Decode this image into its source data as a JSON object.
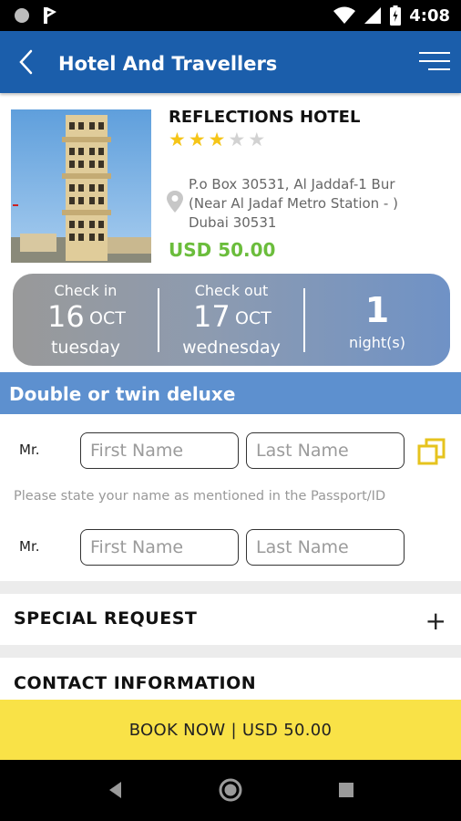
{
  "status_bar": {
    "time": "4:08",
    "icons": [
      "circle-icon",
      "notification-flag-icon",
      "wifi-icon",
      "signal-icon",
      "battery-icon"
    ]
  },
  "app_bar": {
    "title": "Hotel And Travellers",
    "back_icon": "chevron-left-icon",
    "menu_icon": "menu-icon",
    "color": "#1b5eab"
  },
  "hotel": {
    "name": "REFLECTIONS HOTEL",
    "rating": 3,
    "rating_max": 5,
    "address_lines": [
      "P.o Box 30531, Al Jaddaf-1 Bur",
      "(Near Al Jadaf Metro Station - )",
      "Dubai  30531"
    ],
    "price": "USD 50.00",
    "price_color": "#6bbd3c"
  },
  "stay": {
    "check_in": {
      "label": "Check in",
      "day": "16",
      "month": "OCT",
      "weekday": "tuesday"
    },
    "check_out": {
      "label": "Check out",
      "day": "17",
      "month": "OCT",
      "weekday": "wednesday"
    },
    "nights": {
      "count": "1",
      "label": "night(s)"
    }
  },
  "room": {
    "title": "Double or twin deluxe",
    "guests": [
      {
        "salutation": "Mr.",
        "first_placeholder": "First Name",
        "last_placeholder": "Last Name"
      },
      {
        "salutation": "Mr.",
        "first_placeholder": "First Name",
        "last_placeholder": "Last Name"
      }
    ],
    "hint": "Please state your name as mentioned in the Passport/ID"
  },
  "special_request": {
    "title": "SPECIAL REQUEST",
    "expand_icon": "plus-icon"
  },
  "contact": {
    "title": "CONTACT INFORMATION"
  },
  "book_button": {
    "label": "BOOK NOW | USD 50.00",
    "color": "#f9e247"
  }
}
